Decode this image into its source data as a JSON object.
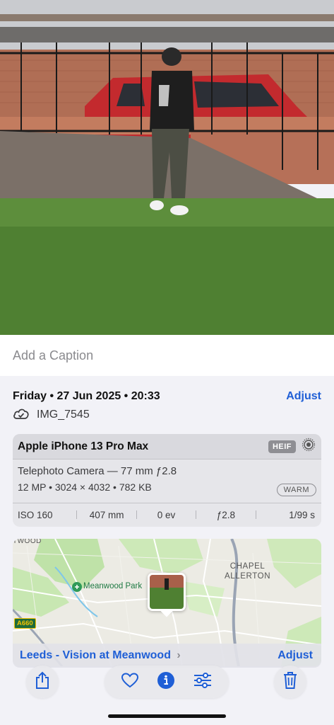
{
  "photo": {
    "description_icon": "photo-image"
  },
  "caption": {
    "placeholder": "Add a Caption"
  },
  "info": {
    "date": "Friday • 27 Jun 2025 • 20:33",
    "adjust_label": "Adjust",
    "filename": "IMG_7545",
    "cloud_icon": "icloud-icon"
  },
  "camera": {
    "device": "Apple iPhone 13 Pro Max",
    "format": "HEIF",
    "lens": "Telephoto Camera — 77 mm ƒ2.8",
    "specs": "12 MP • 3024 × 4032 • 782 KB",
    "style": "WARM",
    "exif": {
      "iso": "ISO 160",
      "focal": "407 mm",
      "ev": "0 ev",
      "aperture": "ƒ2.8",
      "shutter": "1/99 s"
    }
  },
  "map": {
    "park_label": "Meanwood Park",
    "area_line1": "CHAPEL",
    "area_line2": "ALLERTON",
    "partial_label": "TWOOD",
    "road_label": "A660"
  },
  "location": {
    "name": "Leeds - Vision at Meanwood",
    "chevron": "›",
    "adjust_label": "Adjust"
  },
  "toolbar": {
    "share_icon": "share-icon",
    "favorite_icon": "heart-icon",
    "info_icon": "info-icon",
    "edit_icon": "sliders-icon",
    "delete_icon": "trash-icon"
  },
  "colors": {
    "accent": "#1f5fd6",
    "background": "#f2f2f7"
  }
}
